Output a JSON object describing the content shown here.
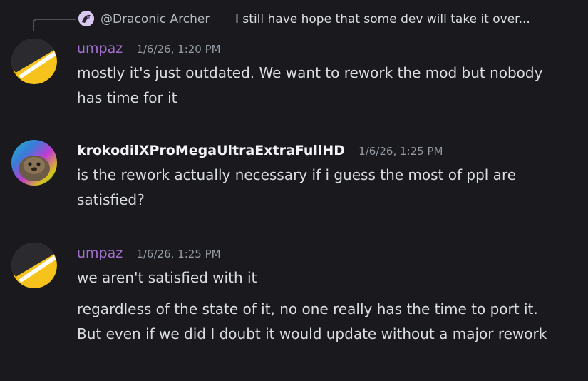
{
  "reply": {
    "author": "@Draconic Archer",
    "text": "I still have hope that some dev will take it over..."
  },
  "messages": [
    {
      "author": "umpaz",
      "author_color": "#a36fcf",
      "timestamp": "1/6/26, 1:20 PM",
      "lines": [
        "mostly it's just outdated. We want to rework the mod but nobody has time for it"
      ]
    },
    {
      "author": "krokodilXProMegaUltraExtraFullHD",
      "author_color": "#f2f3f5",
      "timestamp": "1/6/26, 1:25 PM",
      "lines": [
        "is the rework actually necessary if i guess the most of ppl are satisfied?"
      ]
    },
    {
      "author": "umpaz",
      "author_color": "#a36fcf",
      "timestamp": "1/6/26, 1:25 PM",
      "lines": [
        "we aren't satisfied with it",
        "regardless of the state of it, no one really has the time to port it. But even if we did I doubt it would update without a major rework"
      ]
    }
  ]
}
